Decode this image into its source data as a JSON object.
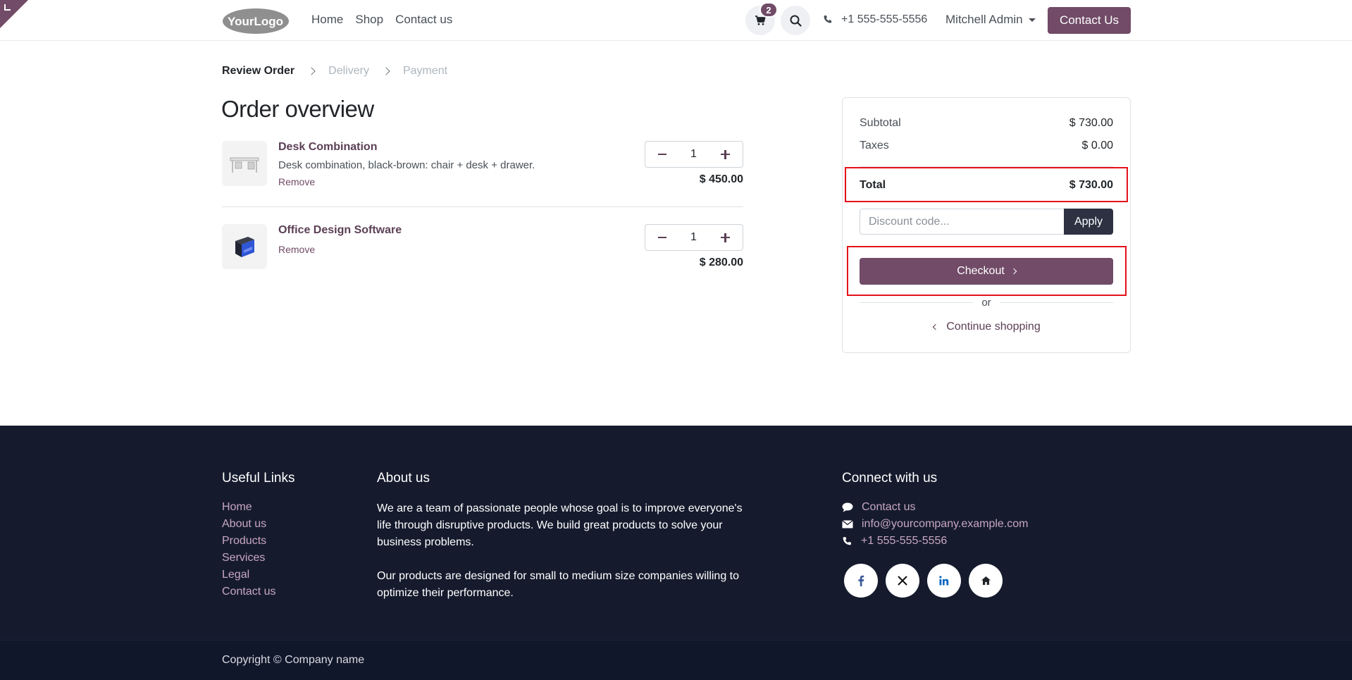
{
  "header": {
    "logo_text": "YourLogo",
    "nav": [
      "Home",
      "Shop",
      "Contact us"
    ],
    "cart_count": "2",
    "phone": "+1 555-555-5556",
    "user": "Mitchell Admin",
    "contact_button": "Contact Us",
    "accent_color": "#714b67"
  },
  "steps": {
    "active": "Review Order",
    "delivery": "Delivery",
    "payment": "Payment"
  },
  "page_title": "Order overview",
  "products": [
    {
      "name": "Desk Combination",
      "description": "Desk combination, black-brown: chair + desk + drawer.",
      "remove": "Remove",
      "quantity": "1",
      "price": "$ 450.00"
    },
    {
      "name": "Office Design Software",
      "remove": "Remove",
      "quantity": "1",
      "price": "$ 280.00"
    }
  ],
  "summary": {
    "subtotal_label": "Subtotal",
    "subtotal_value": "$ 730.00",
    "taxes_label": "Taxes",
    "taxes_value": "$ 0.00",
    "total_label": "Total",
    "total_value": "$ 730.00",
    "discount_placeholder": "Discount code...",
    "apply_label": "Apply",
    "checkout_label": "Checkout",
    "or_label": "or",
    "continue_label": "Continue shopping"
  },
  "footer": {
    "useful_links_title": "Useful Links",
    "useful_links": [
      "Home",
      "About us",
      "Products",
      "Services",
      "Legal",
      "Contact us"
    ],
    "about_title": "About us",
    "about_p1": "We are a team of passionate people whose goal is to improve everyone's life through disruptive products. We build great products to solve your business problems.",
    "about_p2": "Our products are designed for small to medium size companies willing to optimize their performance.",
    "connect_title": "Connect with us",
    "connect_contact": "Contact us",
    "connect_email": "info@yourcompany.example.com",
    "connect_phone": "+1 555-555-5556",
    "social_icons": [
      "facebook-icon",
      "x-icon",
      "linkedin-icon",
      "home-icon"
    ],
    "copyright": "Copyright © Company name"
  }
}
